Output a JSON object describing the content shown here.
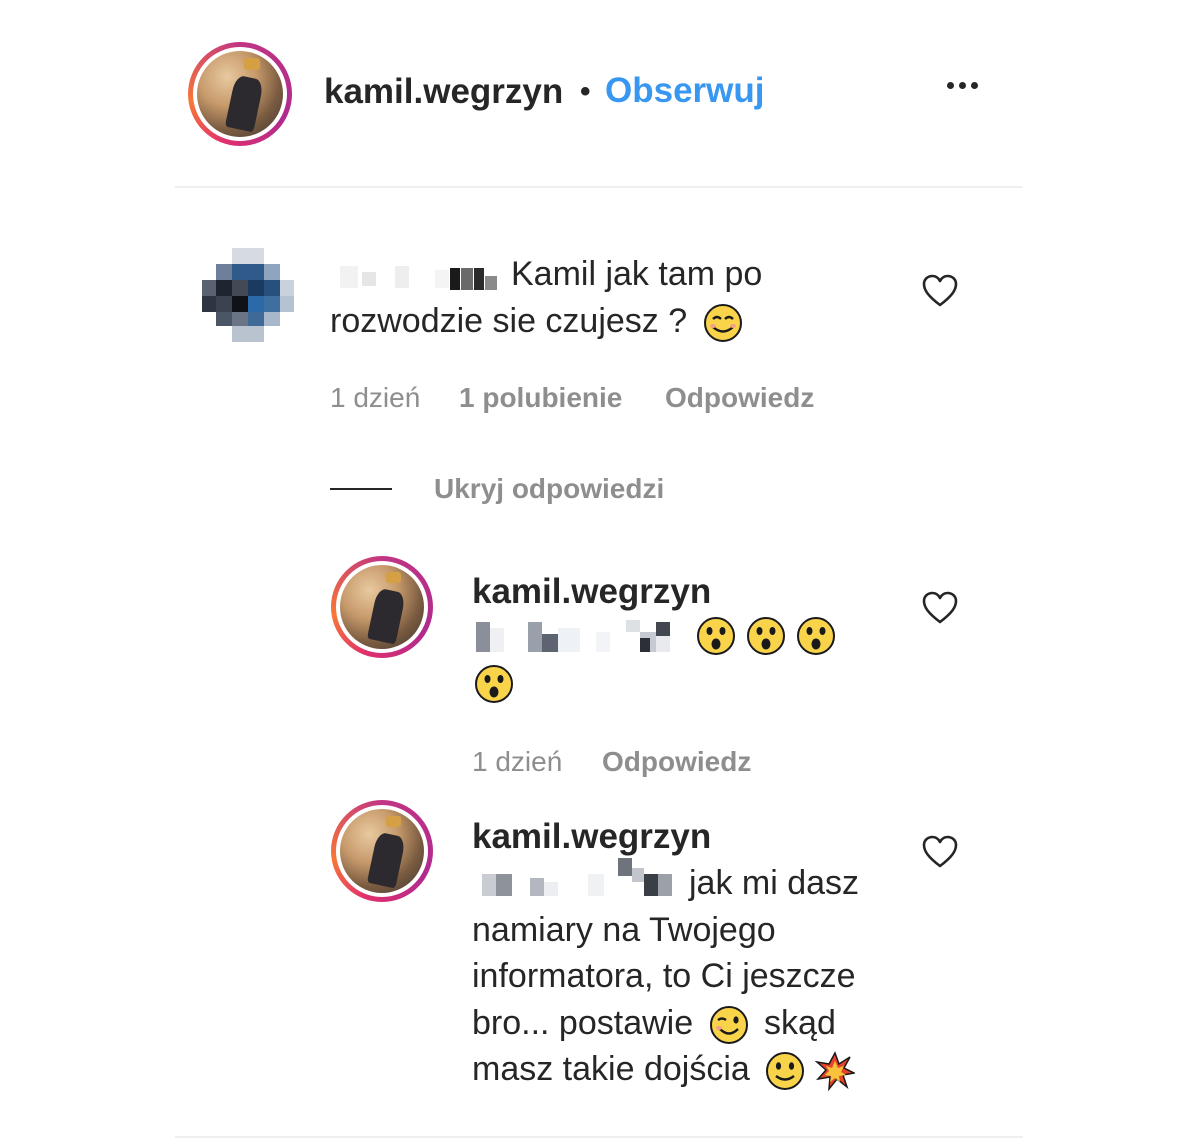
{
  "header": {
    "username": "kamil.wegrzyn",
    "separator": "•",
    "follow_label": "Obserwuj"
  },
  "comment": {
    "text_part1": "Kamil jak tam po",
    "text_part2": "rozwodzie sie czujesz ?",
    "emoji": "smiling-face-icon",
    "time": "1 dzień",
    "likes": "1 polubienie",
    "reply_label": "Odpowiedz"
  },
  "replies_toggle": "Ukryj odpowiedzi",
  "replies": [
    {
      "username": "kamil.wegrzyn",
      "emojis": [
        "astonished-face-icon",
        "astonished-face-icon",
        "astonished-face-icon",
        "astonished-face-icon"
      ],
      "time": "1 dzień",
      "reply_label": "Odpowiedz"
    },
    {
      "username": "kamil.wegrzyn",
      "line1": "jak mi dasz",
      "line2": "namiary na Twojego",
      "line3": "informatora, to Ci jeszcze",
      "line4a": "bro... postawie",
      "line4b": "skąd",
      "line5": "masz takie dojścia"
    }
  ],
  "colors": {
    "link": "#3897f0",
    "text": "#262626",
    "secondary": "#8e8e8e",
    "divider": "#efefef"
  }
}
